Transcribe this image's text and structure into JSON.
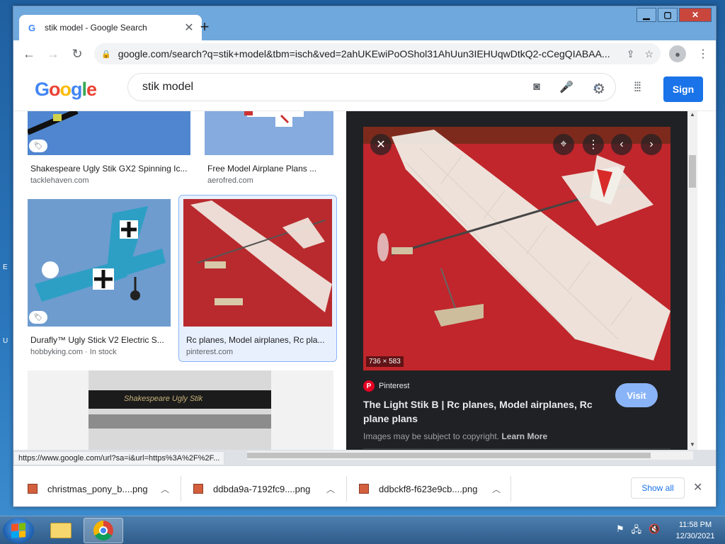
{
  "browser": {
    "tab_title": "stik model - Google Search",
    "url": "google.com/search?q=stik+model&tbm=isch&ved=2ahUKEwiPoOShol31AhUun3IEHUqwDtkQ2-cCegQIABAA...",
    "status_url": "https://www.google.com/url?sa=i&url=https%3A%2F%2F..."
  },
  "google": {
    "logo_letters": [
      "G",
      "o",
      "o",
      "g",
      "l",
      "e"
    ],
    "query": "stik model",
    "sign_in_label": "Sign"
  },
  "results": [
    {
      "title": "Shakespeare Ugly Stik GX2 Spinning Ic...",
      "source": "tacklehaven.com"
    },
    {
      "title": "Free Model Airplane Plans ...",
      "source": "aerofred.com"
    },
    {
      "title": "Durafly™ Ugly Stick V2 Electric S...",
      "source": "hobbyking.com · In stock"
    },
    {
      "title": "Rc planes, Model airplanes, Rc pla...",
      "source": "pinterest.com"
    }
  ],
  "rod_image_text": "Shakespeare  Ugly Stik",
  "preview": {
    "dimensions": "736 × 583",
    "source_name": "Pinterest",
    "title": "The Light Stik B | Rc planes, Model airplanes, Rc plane plans",
    "visit_label": "Visit",
    "copyright_text": "Images may be subject to copyright.",
    "learn_more": "Learn More"
  },
  "downloads": [
    {
      "name": "christmas_pony_b....png"
    },
    {
      "name": "ddbda9a-7192fc9....png"
    },
    {
      "name": "ddbckf8-f623e9cb....png"
    }
  ],
  "downloads_show_all": "Show all",
  "clock": {
    "time": "11:58 PM",
    "date": "12/30/2021"
  },
  "colors": {
    "accent": "#1a73e8",
    "titlebar": "#6fa8dc",
    "preview_bg": "#202124",
    "pinterest": "#e60023"
  }
}
